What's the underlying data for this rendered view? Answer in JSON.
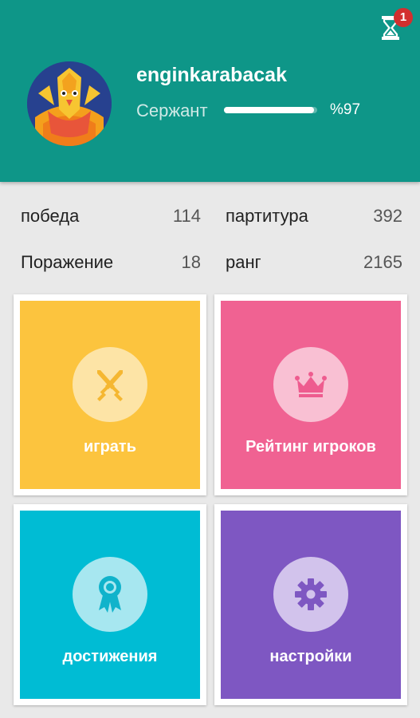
{
  "header": {
    "username": "enginkarabacak",
    "rank": "Сержант",
    "progress_text": "%97",
    "progress_fraction": 0.97,
    "notification_count": "1",
    "hourglass_icon": "hourglass-icon",
    "avatar_icon": "phoenix-avatar"
  },
  "stats": {
    "wins_label": "победа",
    "wins_value": "114",
    "score_label": "партитура",
    "score_value": "392",
    "losses_label": "Поражение",
    "losses_value": "18",
    "rank_label": "ранг",
    "rank_value": "2165"
  },
  "tiles": {
    "play": {
      "label": "играть",
      "color": "#fcc43e",
      "icon": "crossed-swords-icon"
    },
    "leaderboard": {
      "label": "Рейтинг игроков",
      "color": "#f06292",
      "icon": "crown-icon"
    },
    "achievements": {
      "label": "достижения",
      "color": "#00bcd4",
      "icon": "medal-icon"
    },
    "settings": {
      "label": "настройки",
      "color": "#7e57c2",
      "icon": "gear-icon"
    }
  }
}
